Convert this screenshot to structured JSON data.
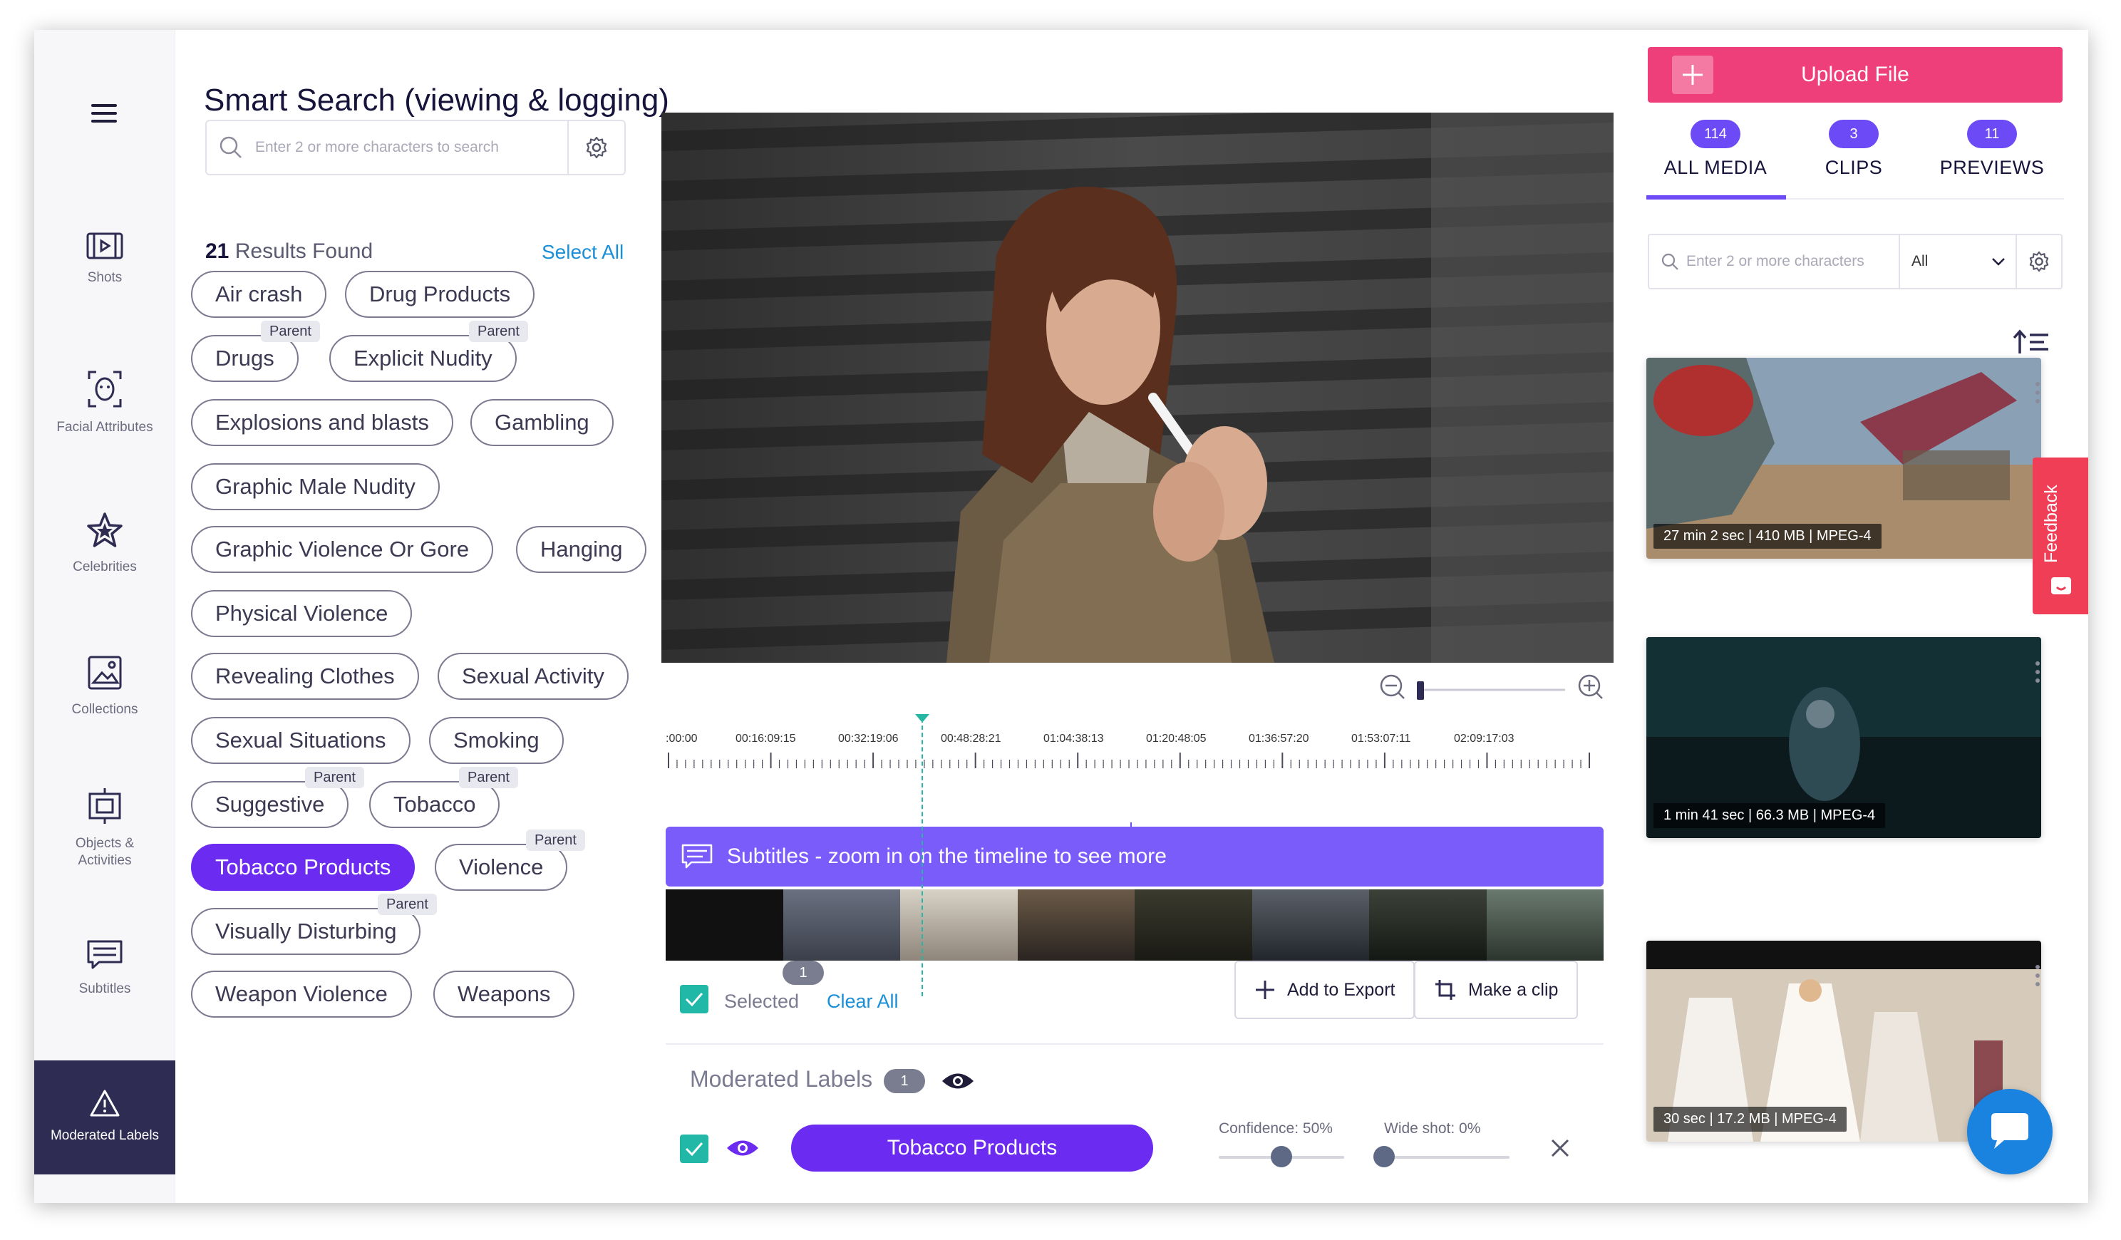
{
  "page_title": "Smart Search (viewing & logging)",
  "search": {
    "placeholder": "Enter 2 or more characters to search"
  },
  "results": {
    "count": "21",
    "label": "Results Found",
    "select_all": "Select All"
  },
  "sidebar": {
    "items": [
      {
        "label": "Shots",
        "icon": "film-icon"
      },
      {
        "label": "Facial Attributes",
        "icon": "face-scan-icon"
      },
      {
        "label": "Celebrities",
        "icon": "star-icon"
      },
      {
        "label": "Collections",
        "icon": "image-gallery-icon"
      },
      {
        "label": "Objects &",
        "label2": "Activities",
        "icon": "object-detect-icon"
      },
      {
        "label": "Subtitles",
        "icon": "subtitles-icon"
      },
      {
        "label": "Moderated Labels",
        "icon": "warning-icon",
        "active": true
      }
    ]
  },
  "chips": [
    {
      "label": "Air crash"
    },
    {
      "label": "Drug Products"
    },
    {
      "label": "Drugs",
      "badge": "Parent"
    },
    {
      "label": "Explicit Nudity",
      "badge": "Parent"
    },
    {
      "label": "Explosions and blasts"
    },
    {
      "label": "Gambling"
    },
    {
      "label": "Graphic Male Nudity"
    },
    {
      "label": "Graphic Violence Or Gore"
    },
    {
      "label": "Hanging"
    },
    {
      "label": "Physical Violence"
    },
    {
      "label": "Revealing Clothes"
    },
    {
      "label": "Sexual Activity"
    },
    {
      "label": "Sexual Situations"
    },
    {
      "label": "Smoking"
    },
    {
      "label": "Suggestive",
      "badge": "Parent"
    },
    {
      "label": "Tobacco",
      "badge": "Parent"
    },
    {
      "label": "Tobacco Products",
      "active": true
    },
    {
      "label": "Violence",
      "badge": "Parent"
    },
    {
      "label": "Visually Disturbing",
      "badge": "Parent"
    },
    {
      "label": "Weapon Violence"
    },
    {
      "label": "Weapons"
    }
  ],
  "timeline": {
    "ticks": [
      ":00:00",
      "00:16:09:15",
      "00:32:19:06",
      "00:48:28:21",
      "01:04:38:13",
      "01:20:48:05",
      "01:36:57:20",
      "01:53:07:11",
      "02:09:17:03"
    ],
    "subtitle_bar": "Subtitles - zoom in on the timeline to see more"
  },
  "selection": {
    "selected_label": "Selected",
    "selected_count": "1",
    "clear_all": "Clear All",
    "add_to_export": "Add to Export",
    "make_clip": "Make a clip"
  },
  "moderated": {
    "title": "Moderated Labels",
    "count": "1",
    "label_button": "Tobacco Products",
    "confidence_label": "Confidence: 50%",
    "confidence_value": 0.5,
    "wide_shot_label": "Wide shot: 0%",
    "wide_shot_value": 0.0
  },
  "right_panel": {
    "upload_label": "Upload File",
    "tabs": [
      {
        "label": "ALL MEDIA",
        "count": "114",
        "active": true
      },
      {
        "label": "CLIPS",
        "count": "3"
      },
      {
        "label": "PREVIEWS",
        "count": "11"
      }
    ],
    "search_placeholder": "Enter 2 or more characters",
    "filter_value": "All",
    "media": [
      {
        "meta": "27 min 2 sec | 410 MB | MPEG-4"
      },
      {
        "meta": "1 min 41 sec | 66.3 MB | MPEG-4"
      },
      {
        "meta": "30 sec | 17.2 MB | MPEG-4"
      }
    ]
  },
  "feedback_label": "Feedback",
  "colors": {
    "accent_purple": "#6c2bf0",
    "upload_pink": "#ee3f7a",
    "teal": "#22b8a8",
    "link_blue": "#1a8fd8"
  }
}
